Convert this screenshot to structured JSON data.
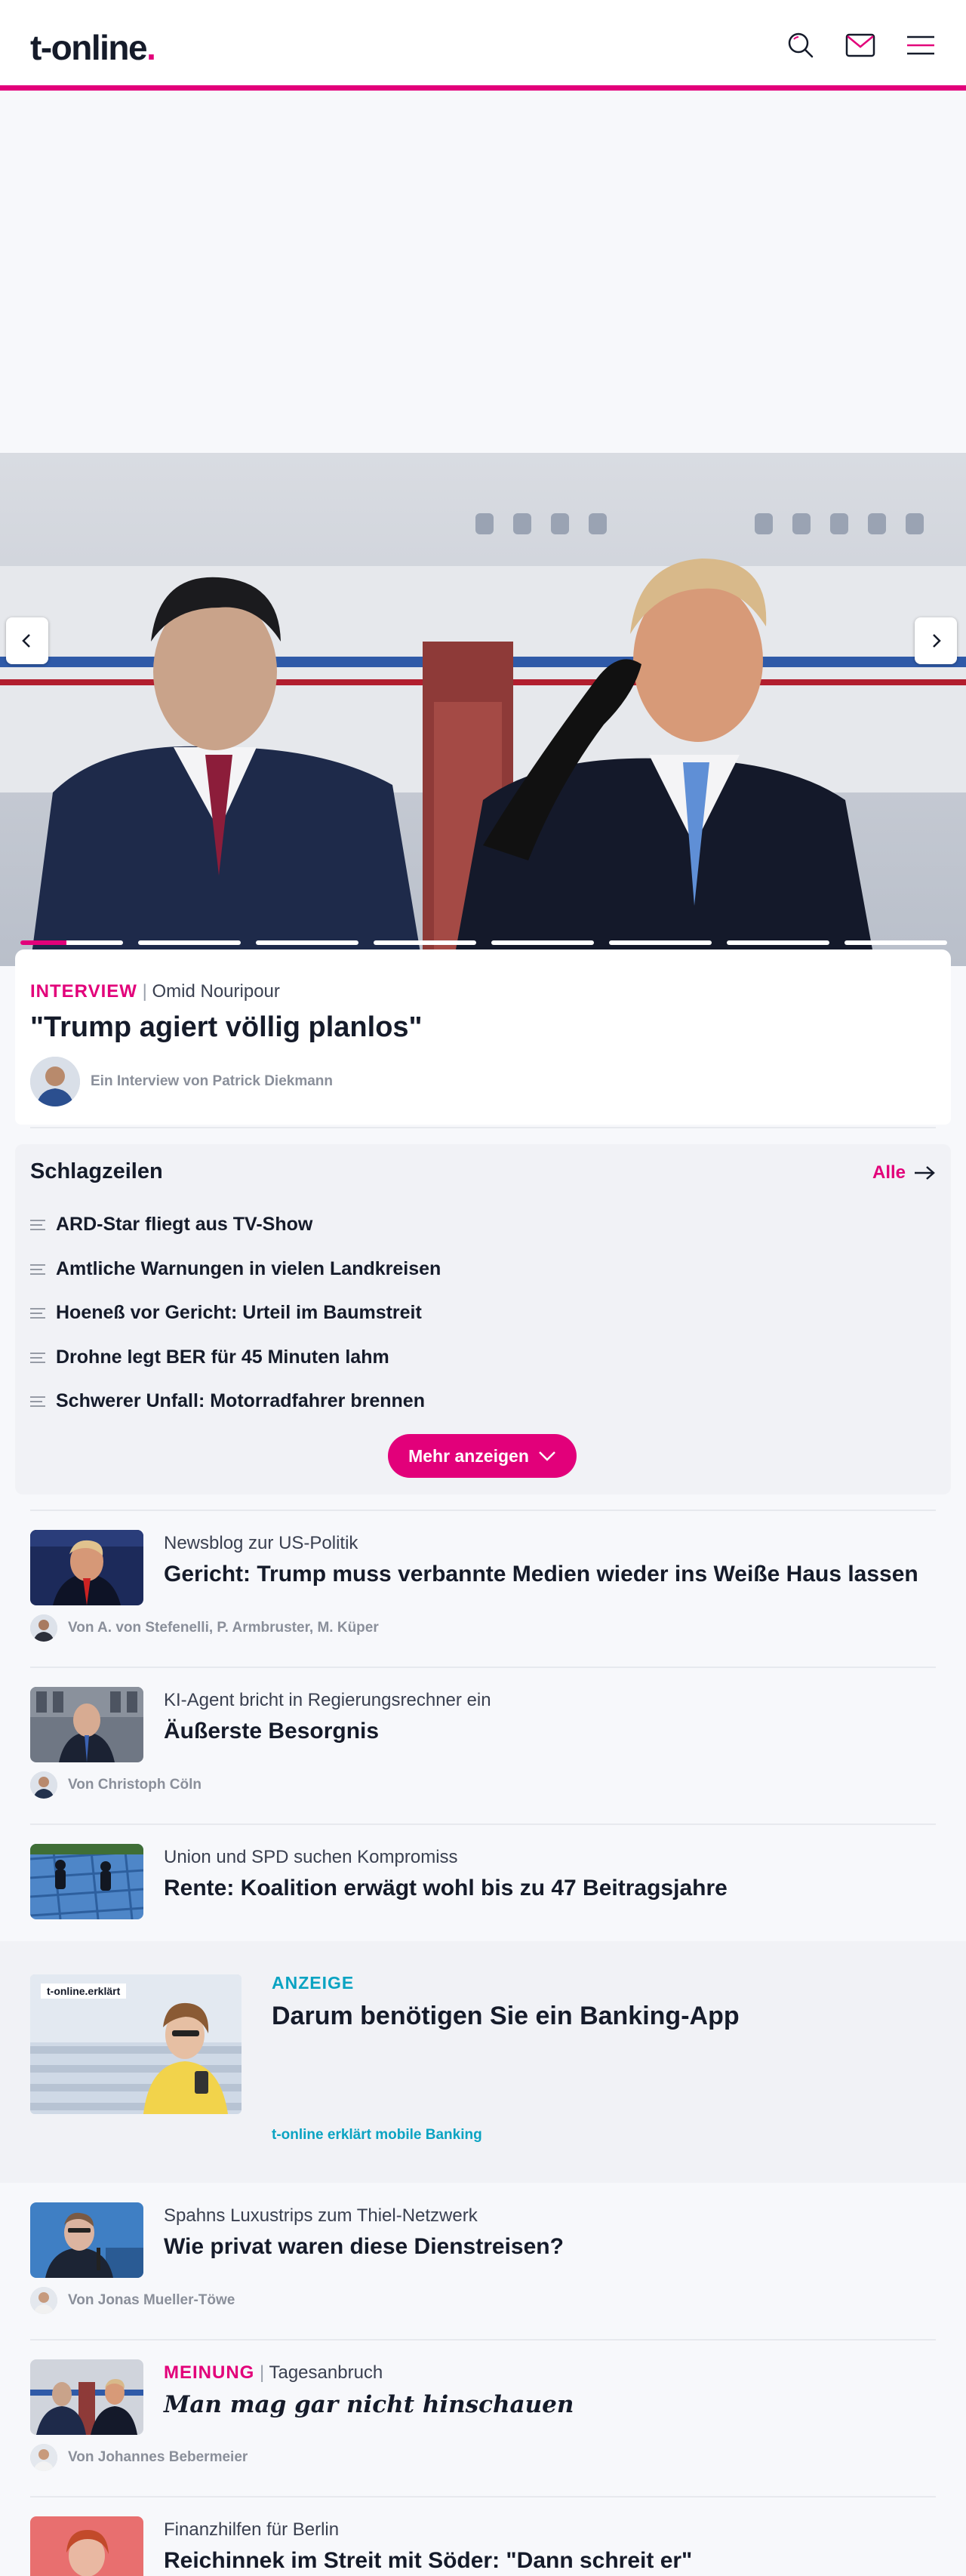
{
  "header": {
    "logo": "t-online",
    "logo_dot": "."
  },
  "hero": {
    "tag": "INTERVIEW",
    "separator": "|",
    "kicker": "Omid Nouripour",
    "title": "\"Trump agiert völlig planlos\"",
    "byline": "Ein Interview von Patrick Diekmann",
    "slides_total": 8,
    "slide_progress": 0.45
  },
  "headlines": {
    "title": "Schlagzeilen",
    "all_label": "Alle",
    "items": [
      "ARD-Star fliegt aus TV-Show",
      "Amtliche Warnungen in vielen Landkreisen",
      "Hoeneß vor Gericht: Urteil im Baumstreit",
      "Drohne legt BER für 45 Minuten lahm",
      "Schwerer Unfall: Motorradfahrer brennen"
    ],
    "more_label": "Mehr anzeigen"
  },
  "articles": [
    {
      "kicker": "Newsblog zur US-Politik",
      "title": "Gericht: Trump muss verbannte Medien wieder ins Weiße Haus lassen",
      "byline": "Von A. von Stefenelli, P. Armbruster, M. Küper"
    },
    {
      "kicker": "KI-Agent bricht in Regierungsrechner ein",
      "title": "Äußerste Besorgnis",
      "byline": "Von Christoph Cöln"
    },
    {
      "kicker": "Union und SPD suchen Kompromiss",
      "title": "Rente: Koalition erwägt wohl bis zu 47 Beitragsjahre",
      "byline": ""
    }
  ],
  "ad": {
    "badge": "t-online.erklärt",
    "label": "ANZEIGE",
    "title": "Darum benötigen Sie ein Banking-App",
    "sub": "t-online erklärt mobile Banking"
  },
  "articles2": [
    {
      "kicker": "Spahns Luxustrips zum Thiel-Netzwerk",
      "title": "Wie privat waren diese Dienstreisen?",
      "byline": "Von Jonas Mueller-Töwe"
    },
    {
      "tag": "MEINUNG",
      "separator": "|",
      "kicker": "Tagesanbruch",
      "title": "Man mag gar nicht hinschauen",
      "byline": "Von Johannes Bebermeier"
    },
    {
      "kicker": "Finanzhilfen für Berlin",
      "title": "Reichinnek im Streit mit Söder: \"Dann schreit er\""
    }
  ],
  "colors": {
    "brand": "#e2007a",
    "ad_accent": "#0aa3c2",
    "text": "#151b2a"
  },
  "icons": [
    "search-icon",
    "mail-icon",
    "menu-icon",
    "chevron-left-icon",
    "chevron-right-icon",
    "headline-lines-icon",
    "arrow-right-icon",
    "chevron-down-icon"
  ]
}
